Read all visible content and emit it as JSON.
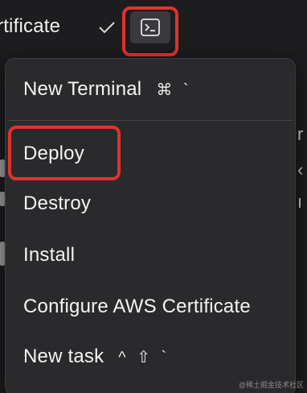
{
  "topbar": {
    "title_fragment": "rtificate"
  },
  "menu": {
    "items": [
      {
        "label": "New Terminal",
        "shortcut": "⌘ `"
      },
      {
        "label": "Deploy"
      },
      {
        "label": "Destroy"
      },
      {
        "label": "Install"
      },
      {
        "label": "Configure AWS Certificate"
      },
      {
        "label": "New task",
        "shortcut": "^ ⇧ `"
      }
    ]
  },
  "watermark": "@稀土掘金技术社区",
  "colors": {
    "highlight": "#e0332d",
    "menu_bg": "#2a2a2d",
    "app_bg": "#1c1c1e"
  },
  "icons": {
    "check": "check-icon",
    "terminal": "terminal-icon"
  }
}
